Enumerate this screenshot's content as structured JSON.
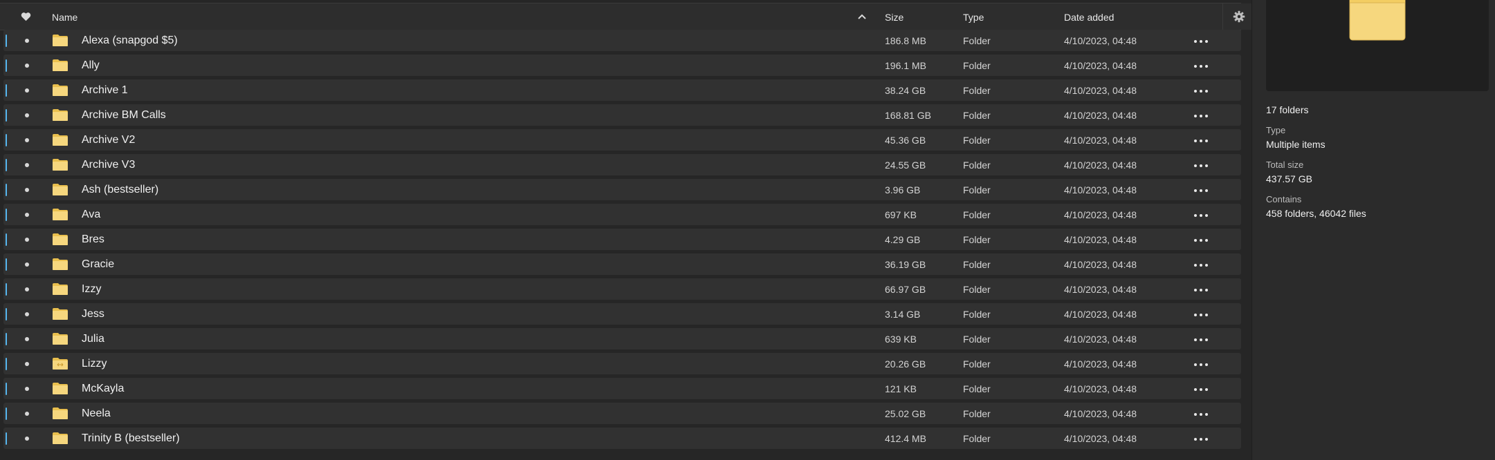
{
  "columns": {
    "name": "Name",
    "size": "Size",
    "type": "Type",
    "date_added": "Date added"
  },
  "icons": {
    "favorite": "heart-icon",
    "sort": "sort-ascending-icon",
    "settings": "gear-icon",
    "folder": "folder-icon",
    "more": "more-horizontal-icon"
  },
  "rows": [
    {
      "name": "Alexa (snapgod $5)",
      "size": "186.8 MB",
      "type": "Folder",
      "date": "4/10/2023, 04:48"
    },
    {
      "name": "Ally",
      "size": "196.1 MB",
      "type": "Folder",
      "date": "4/10/2023, 04:48"
    },
    {
      "name": "Archive 1",
      "size": "38.24 GB",
      "type": "Folder",
      "date": "4/10/2023, 04:48"
    },
    {
      "name": "Archive BM Calls",
      "size": "168.81 GB",
      "type": "Folder",
      "date": "4/10/2023, 04:48"
    },
    {
      "name": "Archive V2",
      "size": "45.36 GB",
      "type": "Folder",
      "date": "4/10/2023, 04:48"
    },
    {
      "name": "Archive V3",
      "size": "24.55 GB",
      "type": "Folder",
      "date": "4/10/2023, 04:48"
    },
    {
      "name": "Ash (bestseller)",
      "size": "3.96 GB",
      "type": "Folder",
      "date": "4/10/2023, 04:48"
    },
    {
      "name": "Ava",
      "size": "697 KB",
      "type": "Folder",
      "date": "4/10/2023, 04:48"
    },
    {
      "name": "Bres",
      "size": "4.29 GB",
      "type": "Folder",
      "date": "4/10/2023, 04:48"
    },
    {
      "name": "Gracie",
      "size": "36.19 GB",
      "type": "Folder",
      "date": "4/10/2023, 04:48"
    },
    {
      "name": "Izzy",
      "size": "66.97 GB",
      "type": "Folder",
      "date": "4/10/2023, 04:48"
    },
    {
      "name": "Jess",
      "size": "3.14 GB",
      "type": "Folder",
      "date": "4/10/2023, 04:48"
    },
    {
      "name": "Julia",
      "size": "639 KB",
      "type": "Folder",
      "date": "4/10/2023, 04:48"
    },
    {
      "name": "Lizzy",
      "size": "20.26 GB",
      "type": "Folder",
      "date": "4/10/2023, 04:48",
      "shared": true
    },
    {
      "name": "McKayla",
      "size": "121 KB",
      "type": "Folder",
      "date": "4/10/2023, 04:48"
    },
    {
      "name": "Neela",
      "size": "25.02 GB",
      "type": "Folder",
      "date": "4/10/2023, 04:48"
    },
    {
      "name": "Trinity B (bestseller)",
      "size": "412.4 MB",
      "type": "Folder",
      "date": "4/10/2023, 04:48"
    }
  ],
  "details": {
    "summary": "17 folders",
    "type_label": "Type",
    "type_value": "Multiple items",
    "total_size_label": "Total size",
    "total_size_value": "437.57 GB",
    "contains_label": "Contains",
    "contains_value": "458 folders, 46042 files"
  },
  "colors": {
    "accent": "#57b7f0",
    "folder": "#f6d77e",
    "row_bg": "#313131",
    "panel_bg": "#2b2b2b"
  }
}
